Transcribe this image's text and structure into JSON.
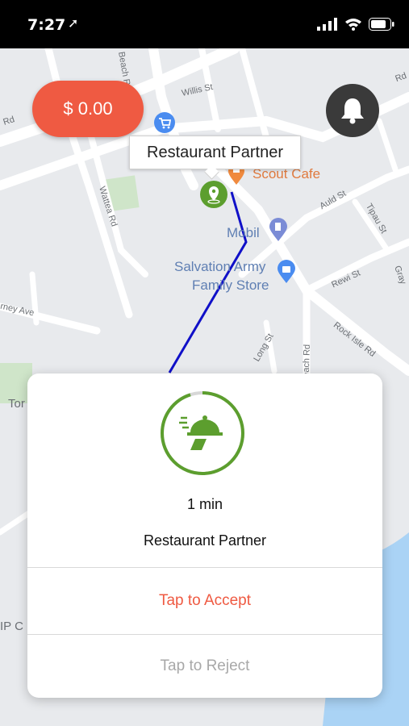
{
  "status_bar": {
    "time": "7:27"
  },
  "balance": {
    "amount": "$ 0.00"
  },
  "map": {
    "tooltip": "Restaurant Partner",
    "streets": [
      "Willis St",
      "Wattea Rd",
      "Auld St",
      "Tipau St",
      "Rewi St",
      "Rock Isle Rd",
      "Long St",
      "Beach Rd",
      "rney Ave",
      "Rd",
      "Rd",
      "Gray",
      "Tor",
      "IP C"
    ],
    "pois": {
      "scout_cafe": "Scout Cafe",
      "mobil": "Mobil",
      "salvation_line1": "Salvation Army",
      "salvation_line2": "Family Store"
    }
  },
  "order_card": {
    "eta": "1 min",
    "partner": "Restaurant Partner",
    "accept_label": "Tap to Accept",
    "reject_label": "Tap to Reject",
    "timer_progress": 0.95
  },
  "colors": {
    "accent": "#ef5a42",
    "green": "#5c9e2e",
    "route": "#1010c8"
  }
}
